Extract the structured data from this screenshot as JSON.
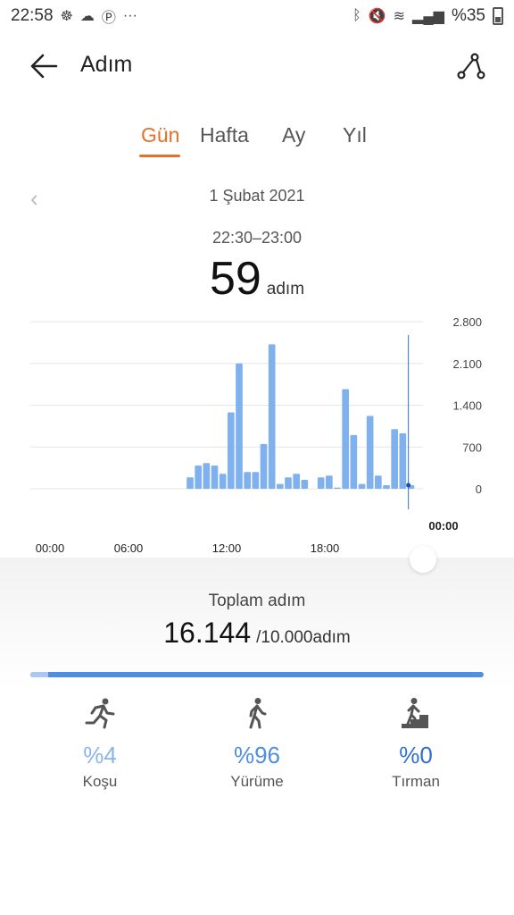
{
  "status_bar": {
    "time": "22:58",
    "battery": "%35"
  },
  "app_bar": {
    "title": "Adım"
  },
  "tabs": [
    {
      "label": "Gün",
      "active": true
    },
    {
      "label": "Hafta",
      "active": false
    },
    {
      "label": "Ay",
      "active": false
    },
    {
      "label": "Yıl",
      "active": false
    }
  ],
  "date_nav": {
    "date": "1 Şubat 2021"
  },
  "selection": {
    "time_range": "22:30–23:00",
    "steps": "59",
    "unit": "adım"
  },
  "chart_data": {
    "type": "bar",
    "x_ticks": [
      "00:00",
      "06:00",
      "12:00",
      "18:00"
    ],
    "selected_tick": "00:00",
    "y_ticks": [
      "2.800",
      "2.100",
      "1.400",
      "700",
      "0"
    ],
    "ylim": [
      0,
      2800
    ],
    "bar_width_hours": 0.5,
    "bars": [
      {
        "t": 9.5,
        "v": 190
      },
      {
        "t": 10.0,
        "v": 390
      },
      {
        "t": 10.5,
        "v": 430
      },
      {
        "t": 11.0,
        "v": 390
      },
      {
        "t": 11.5,
        "v": 250
      },
      {
        "t": 12.0,
        "v": 1280
      },
      {
        "t": 12.5,
        "v": 2100
      },
      {
        "t": 13.0,
        "v": 280
      },
      {
        "t": 13.5,
        "v": 280
      },
      {
        "t": 14.0,
        "v": 750
      },
      {
        "t": 14.5,
        "v": 2420
      },
      {
        "t": 15.0,
        "v": 80
      },
      {
        "t": 15.5,
        "v": 190
      },
      {
        "t": 16.0,
        "v": 250
      },
      {
        "t": 16.5,
        "v": 150
      },
      {
        "t": 17.5,
        "v": 190
      },
      {
        "t": 18.0,
        "v": 220
      },
      {
        "t": 18.5,
        "v": 20
      },
      {
        "t": 19.0,
        "v": 1670
      },
      {
        "t": 19.5,
        "v": 900
      },
      {
        "t": 20.0,
        "v": 80
      },
      {
        "t": 20.5,
        "v": 1220
      },
      {
        "t": 21.0,
        "v": 220
      },
      {
        "t": 21.5,
        "v": 60
      },
      {
        "t": 22.0,
        "v": 1000
      },
      {
        "t": 22.5,
        "v": 930
      },
      {
        "t": 23.0,
        "v": 59
      }
    ]
  },
  "summary": {
    "label": "Toplam adım",
    "total": "16.144",
    "goal": "/10.000adım",
    "progress_fraction": 0.04
  },
  "breakdown": [
    {
      "name": "Koşu",
      "percent": "%4",
      "icon": "running-icon",
      "color": "#8ab4ea"
    },
    {
      "name": "Yürüme",
      "percent": "%96",
      "icon": "walking-icon",
      "color": "#4f8ee0"
    },
    {
      "name": "Tırman",
      "percent": "%0",
      "icon": "climbing-icon",
      "color": "#2f6fd0"
    }
  ]
}
